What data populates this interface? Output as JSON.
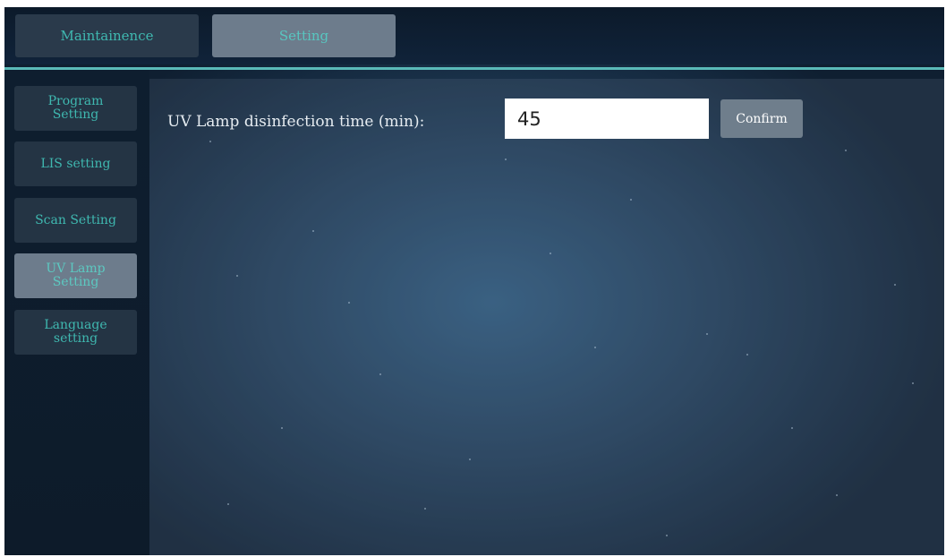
{
  "topbar": {
    "tabs": [
      {
        "label": "Maintainence",
        "active": false
      },
      {
        "label": "Setting",
        "active": true
      }
    ]
  },
  "sidebar": {
    "items": [
      {
        "label": "Program\nSetting",
        "active": false
      },
      {
        "label": "LIS setting",
        "active": false
      },
      {
        "label": "Scan Setting",
        "active": false
      },
      {
        "label": "UV Lamp\nSetting",
        "active": true
      },
      {
        "label": "Language\nsetting",
        "active": false
      }
    ]
  },
  "main": {
    "uv_label": "UV Lamp disinfection time (min):",
    "uv_value": "45",
    "confirm_label": "Confirm"
  },
  "colors": {
    "accent": "#5ab9b8",
    "text_teal": "#3fb8b0",
    "active_button": "#6d7c8c",
    "inactive_button": "#243444"
  }
}
